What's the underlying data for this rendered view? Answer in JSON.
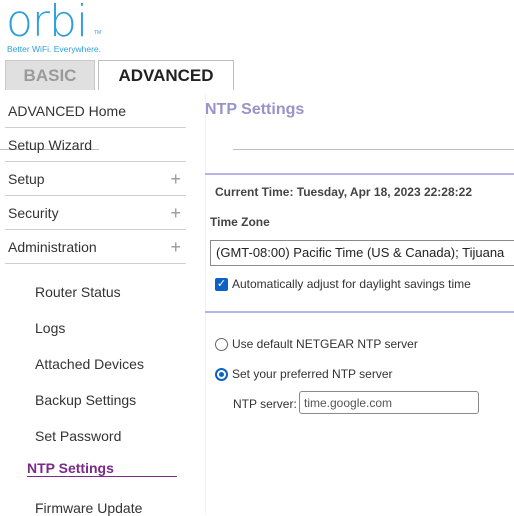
{
  "brand": {
    "logo_text": "orbi",
    "tm": "TM",
    "tagline": "Better WiFi. Everywhere."
  },
  "tabs": [
    {
      "label": "BASIC",
      "active": false
    },
    {
      "label": "ADVANCED",
      "active": true
    }
  ],
  "sidebar": {
    "top_items": [
      {
        "label": "ADVANCED Home",
        "expandable": false
      },
      {
        "label": "Setup Wizard",
        "expandable": false
      },
      {
        "label": "Setup",
        "expandable": true
      },
      {
        "label": "Security",
        "expandable": true
      },
      {
        "label": "Administration",
        "expandable": true
      }
    ],
    "expand_symbol": "+",
    "sub_items": [
      {
        "label": "Router Status"
      },
      {
        "label": "Logs"
      },
      {
        "label": "Attached Devices"
      },
      {
        "label": "Backup Settings"
      },
      {
        "label": "Set Password"
      },
      {
        "label": "NTP Settings",
        "active": true
      },
      {
        "label": "Firmware Update"
      }
    ]
  },
  "main": {
    "title": "NTP Settings",
    "current_time": "Current Time: Tuesday, Apr 18, 2023 22:28:22",
    "time_zone_label": "Time Zone",
    "time_zone_value": "(GMT-08:00) Pacific Time (US & Canada); Tijuana",
    "dst_checkbox": {
      "label": "Automatically adjust for daylight savings time",
      "checked": true
    },
    "ntp_options": [
      {
        "label": "Use default NETGEAR NTP server",
        "selected": false
      },
      {
        "label": "Set your preferred NTP server",
        "selected": true
      }
    ],
    "ntp_server": {
      "label": "NTP server:",
      "value": "time.google.com"
    }
  },
  "colors": {
    "brand": "#2fa0da",
    "title": "#9694c9",
    "rule": "#b7b4e6",
    "active_nav": "#7a2a87",
    "control_blue": "#0b62c4"
  }
}
